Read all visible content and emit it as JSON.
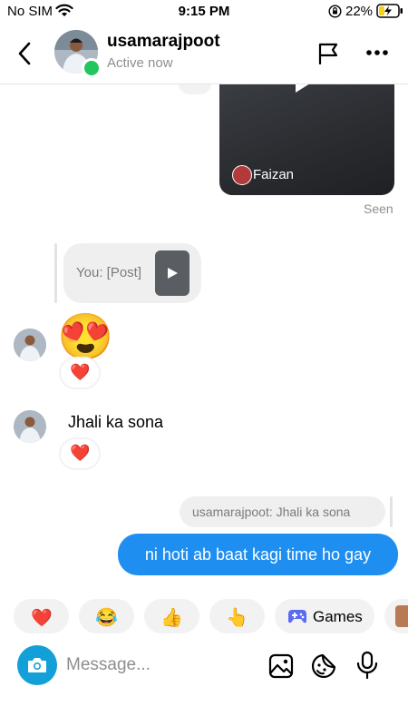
{
  "status_bar": {
    "carrier": "No SIM",
    "time": "9:15 PM",
    "battery": "22%"
  },
  "header": {
    "username": "usamarajpoot",
    "status": "Active now"
  },
  "messages": {
    "shared_video_author": "Faizan",
    "seen_label": "Seen",
    "reply_preview": "You: [Post]",
    "emoji_message": "😍",
    "reaction_heart": "❤️",
    "text_message": "Jhali ka sona",
    "quoted_reply": "usamarajpoot: Jhali ka sona",
    "sent_message": "ni hoti ab baat kagi time ho gay"
  },
  "quick_reactions": {
    "heart": "❤️",
    "laugh": "😂",
    "thumbs": "👍",
    "point": "👆",
    "games_label": "Games"
  },
  "composer": {
    "placeholder": "Message..."
  },
  "colors": {
    "accent": "#1f8ef1",
    "online": "#22c55e",
    "camera": "#13a0d8"
  }
}
